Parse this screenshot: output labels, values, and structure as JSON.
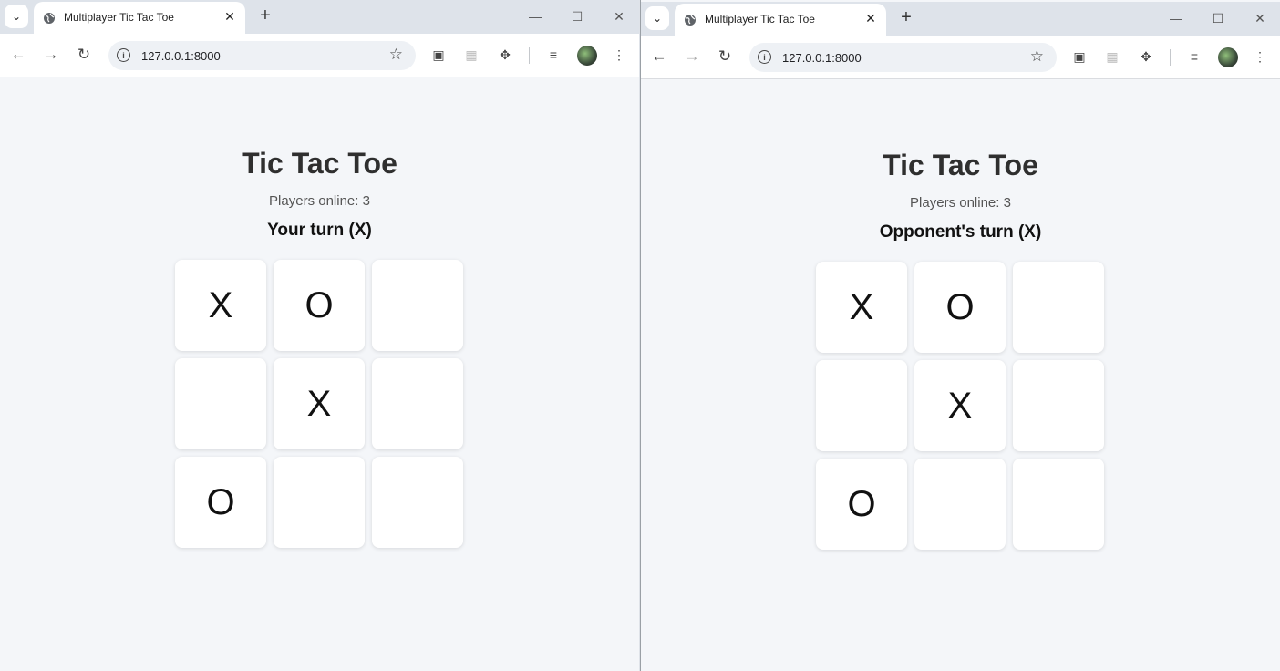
{
  "windows": [
    {
      "tab_title": "Multiplayer Tic Tac Toe",
      "url": "127.0.0.1:8000",
      "game": {
        "title": "Tic Tac Toe",
        "players_online": "Players online: 3",
        "turn_status": "Your turn (X)",
        "board": [
          "X",
          "O",
          "",
          "",
          "X",
          "",
          "O",
          "",
          ""
        ]
      }
    },
    {
      "tab_title": "Multiplayer Tic Tac Toe",
      "url": "127.0.0.1:8000",
      "game": {
        "title": "Tic Tac Toe",
        "players_online": "Players online: 3",
        "turn_status": "Opponent's turn (X)",
        "board": [
          "X",
          "O",
          "",
          "",
          "X",
          "",
          "O",
          "",
          ""
        ]
      }
    }
  ]
}
